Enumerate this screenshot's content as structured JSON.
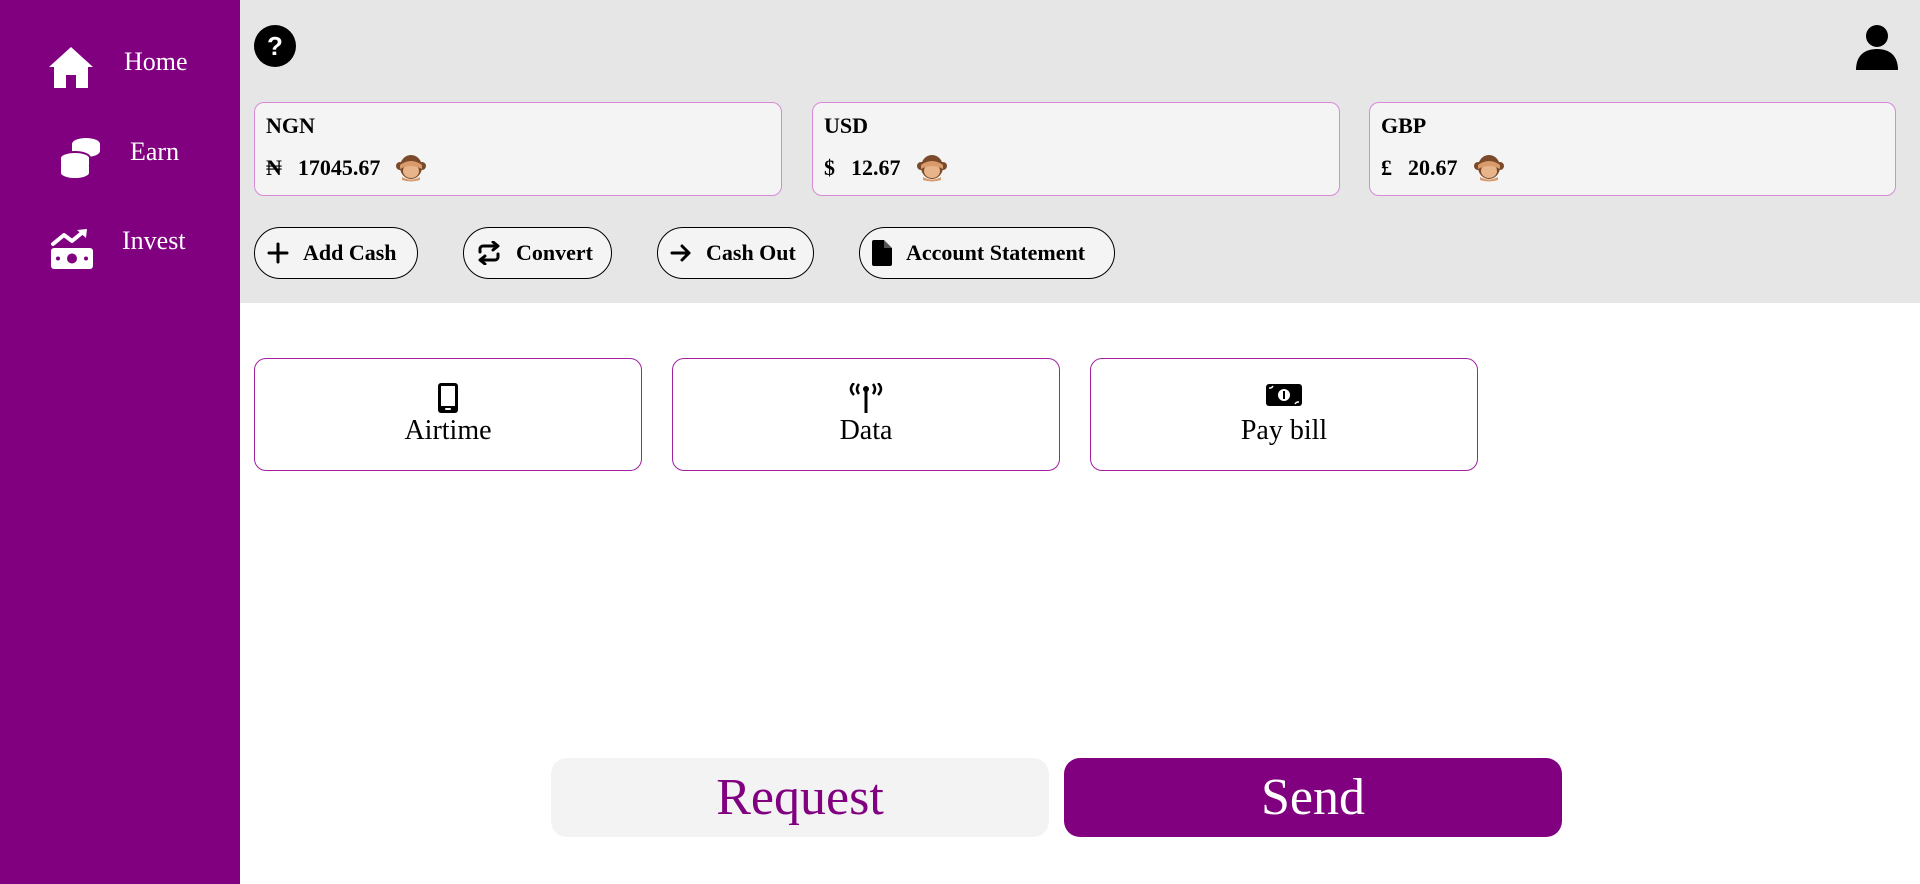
{
  "colors": {
    "brand": "#800080",
    "topbar_bg": "#e7e6e6",
    "card_bg": "#f5f4f5",
    "card_border": "#d78ad7",
    "service_border": "#a020a0"
  },
  "sidebar": {
    "items": [
      {
        "label": "Home",
        "icon": "home-icon"
      },
      {
        "label": "Earn",
        "icon": "coins-icon"
      },
      {
        "label": "Invest",
        "icon": "money-growth-icon"
      }
    ]
  },
  "header": {
    "help_label": "?",
    "help_icon": "question-icon",
    "profile_icon": "user-icon"
  },
  "wallets": [
    {
      "code": "NGN",
      "symbol": "₦",
      "amount": "17045.67",
      "hide_icon": "see-no-evil-monkey-icon"
    },
    {
      "code": "USD",
      "symbol": "$",
      "amount": "12.67",
      "hide_icon": "see-no-evil-monkey-icon"
    },
    {
      "code": "GBP",
      "symbol": "£",
      "amount": "20.67",
      "hide_icon": "see-no-evil-monkey-icon"
    }
  ],
  "actions": [
    {
      "label": "Add Cash",
      "icon": "plus-icon"
    },
    {
      "label": "Convert",
      "icon": "repeat-icon"
    },
    {
      "label": "Cash Out",
      "icon": "arrow-right-icon"
    },
    {
      "label": "Account Statement",
      "icon": "file-icon"
    }
  ],
  "services": [
    {
      "label": "Airtime",
      "icon": "mobile-phone-icon"
    },
    {
      "label": "Data",
      "icon": "tower-broadcast-icon"
    },
    {
      "label": "Pay bill",
      "icon": "money-bill-icon"
    }
  ],
  "footer": {
    "request_label": "Request",
    "send_label": "Send"
  }
}
